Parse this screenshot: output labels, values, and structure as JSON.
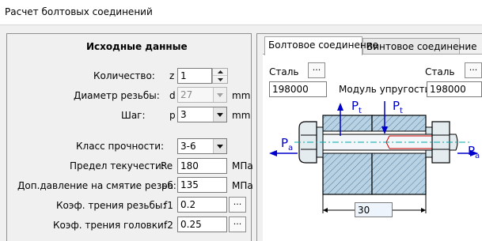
{
  "window": {
    "title": "Расчет болтовых соединений"
  },
  "input_panel": {
    "heading": "Исходные данные",
    "rows": [
      {
        "label": "Количество:",
        "symbol": "z",
        "value": "1"
      },
      {
        "label": "Диаметр резьбы:",
        "symbol": "d",
        "value": "27",
        "unit": "mm"
      },
      {
        "label": "Шаг:",
        "symbol": "p",
        "value": "3",
        "unit": "mm"
      },
      {
        "label": "Класс прочности:",
        "value": "3-6"
      },
      {
        "label": "Предел текучести:",
        "symbol": "Re",
        "value": "180",
        "unit": "МПа"
      },
      {
        "label": "Доп.давление на смятие резьб:",
        "symbol": "pa",
        "value": "135",
        "unit": "МПа"
      },
      {
        "label": "Коэф. трения резьбы:",
        "symbol": "f1",
        "value": "0.2",
        "button": "..."
      },
      {
        "label": "Коэф. трения головки:",
        "symbol": "f2",
        "value": "0.25",
        "button": "..."
      }
    ]
  },
  "tabs": [
    {
      "label": "Болтовое соединение",
      "active": true
    },
    {
      "label": "Винтовое соединение",
      "active": false
    }
  ],
  "bolt_tab": {
    "left_material": {
      "label": "Сталь",
      "button": "...",
      "modulus": "198000"
    },
    "right_material": {
      "label": "Сталь",
      "button": "...",
      "modulus": "198000"
    },
    "modulus_label": "Модуль упругости",
    "force_pt_left": "P",
    "force_pt_left_sub": "t",
    "force_pt_right": "P",
    "force_pt_right_sub": "t",
    "force_pa_left": "P",
    "force_pa_left_sub": "a",
    "force_pa_right": "P",
    "force_pa_right_sub": "a",
    "length_value": "30"
  },
  "colors": {
    "force_arrow": "#0000cc",
    "hatch": "#9fbfd6",
    "axis": "#00a0a0",
    "thread_line": "#ff0000"
  }
}
